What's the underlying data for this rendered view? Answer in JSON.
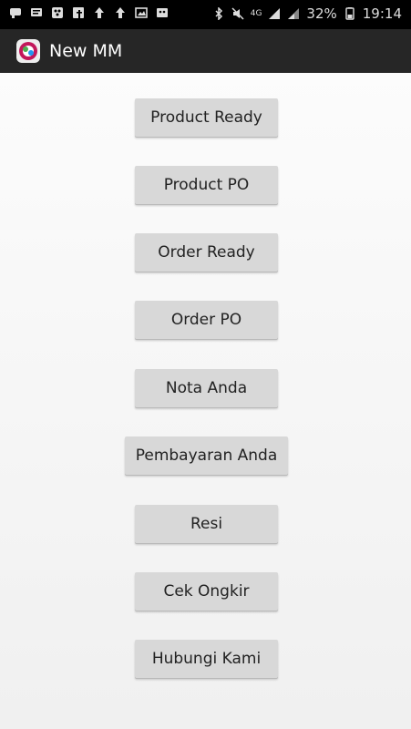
{
  "status_bar": {
    "battery_percent": "32%",
    "time": "19:14",
    "signal_label": "4G"
  },
  "app_bar": {
    "title": "New MM"
  },
  "menu": {
    "items": [
      {
        "id": "product-ready",
        "label": "Product Ready"
      },
      {
        "id": "product-po",
        "label": "Product PO"
      },
      {
        "id": "order-ready",
        "label": "Order Ready"
      },
      {
        "id": "order-po",
        "label": "Order PO"
      },
      {
        "id": "nota-anda",
        "label": "Nota Anda"
      },
      {
        "id": "pembayaran-anda",
        "label": "Pembayaran Anda"
      },
      {
        "id": "resi",
        "label": "Resi"
      },
      {
        "id": "cek-ongkir",
        "label": "Cek Ongkir"
      },
      {
        "id": "hubungi-kami",
        "label": "Hubungi Kami"
      }
    ]
  },
  "colors": {
    "status_bar": "#000000",
    "app_bar": "#262626",
    "button": "#d8d8d8",
    "button_text": "#222222"
  }
}
